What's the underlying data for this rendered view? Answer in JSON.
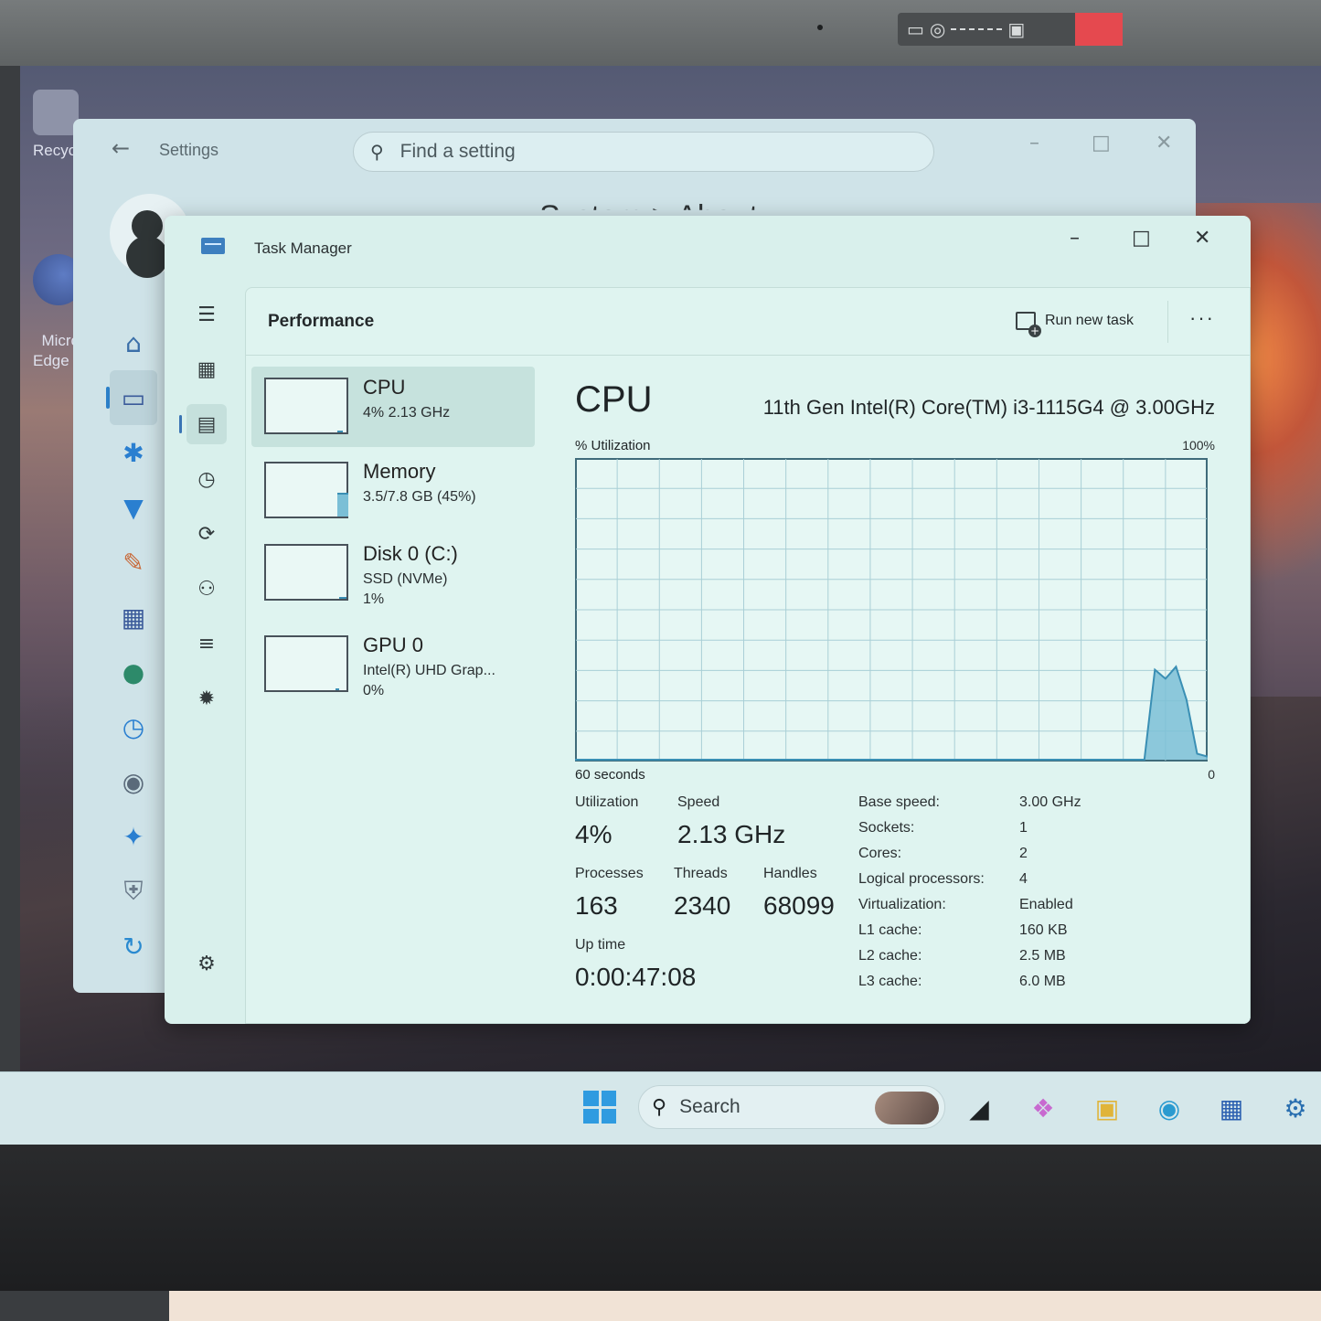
{
  "desktop": {
    "icons": [
      {
        "label": "Recycle",
        "icon": "recycle-bin-icon"
      },
      {
        "label": "Micros\nEdge",
        "icon": "edge-icon"
      }
    ]
  },
  "settings": {
    "title": "Settings",
    "search_placeholder": "Find a setting",
    "heading": "System > About",
    "nav_icons": [
      "home-icon",
      "system-icon",
      "bluetooth-icon",
      "wifi-icon",
      "personalization-icon",
      "apps-icon",
      "accounts-icon",
      "time-language-icon",
      "gaming-icon",
      "accessibility-icon",
      "privacy-icon",
      "windows-update-icon"
    ]
  },
  "task_manager": {
    "title": "Task Manager",
    "page_title": "Performance",
    "run_new_task": "Run new task",
    "more": "···",
    "resources": [
      {
        "name": "CPU",
        "line1": "4%  2.13 GHz",
        "line2": "",
        "level": 0.04
      },
      {
        "name": "Memory",
        "line1": "3.5/7.8 GB (45%)",
        "line2": "",
        "level": 0.45
      },
      {
        "name": "Disk 0 (C:)",
        "line1": "SSD (NVMe)",
        "line2": "1%",
        "level": 0.01
      },
      {
        "name": "GPU 0",
        "line1": "Intel(R) UHD Grap...",
        "line2": "0%",
        "level": 0.0
      }
    ],
    "detail": {
      "title": "CPU",
      "model": "11th Gen Intel(R) Core(TM) i3-1115G4 @ 3.00GHz",
      "y_label": "% Utilization",
      "y_max_label": "100%",
      "x_label": "60 seconds",
      "x_min_label": "0",
      "stats": {
        "utilization_label": "Utilization",
        "utilization": "4%",
        "speed_label": "Speed",
        "speed": "2.13 GHz",
        "processes_label": "Processes",
        "processes": "163",
        "threads_label": "Threads",
        "threads": "2340",
        "handles_label": "Handles",
        "handles": "68099",
        "uptime_label": "Up time",
        "uptime": "0:00:47:08"
      },
      "specs": [
        {
          "key": "Base speed:",
          "value": "3.00 GHz"
        },
        {
          "key": "Sockets:",
          "value": "1"
        },
        {
          "key": "Cores:",
          "value": "2"
        },
        {
          "key": "Logical processors:",
          "value": "4"
        },
        {
          "key": "Virtualization:",
          "value": "Enabled"
        },
        {
          "key": "L1 cache:",
          "value": "160 KB"
        },
        {
          "key": "L2 cache:",
          "value": "2.5 MB"
        },
        {
          "key": "L3 cache:",
          "value": "6.0 MB"
        }
      ]
    },
    "cpu_history_percent": [
      0,
      0,
      0,
      0,
      0,
      0,
      0,
      0,
      0,
      0,
      0,
      0,
      0,
      0,
      0,
      0,
      0,
      0,
      0,
      0,
      0,
      0,
      0,
      0,
      0,
      0,
      0,
      0,
      0,
      0,
      0,
      0,
      0,
      0,
      0,
      0,
      0,
      0,
      0,
      0,
      0,
      0,
      0,
      0,
      0,
      0,
      0,
      0,
      0,
      0,
      0,
      0,
      0,
      0,
      0,
      30,
      27,
      31,
      20,
      2,
      1
    ]
  },
  "taskbar": {
    "search_placeholder": "Search",
    "apps": [
      "start-icon",
      "task-view-icon",
      "copilot-icon",
      "file-explorer-icon",
      "edge-icon",
      "store-icon",
      "settings-icon"
    ]
  },
  "colors": {
    "graph_line": "#3a8fb4",
    "graph_fill": "#7bbfd6",
    "accent": "#2b7fc8"
  }
}
